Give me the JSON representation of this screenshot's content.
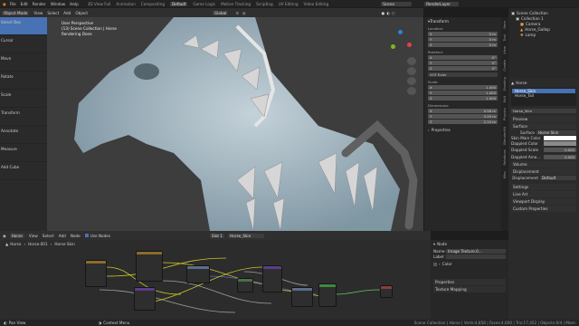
{
  "topbar": {
    "menus": [
      "File",
      "Edit",
      "Render",
      "Window",
      "Help"
    ],
    "tabs": [
      "3D View Full",
      "Animation",
      "Compositing",
      "Default",
      "Game Logic",
      "Motion Tracking",
      "Scripting",
      "UV Editing",
      "Video Editing"
    ],
    "active_tab": "Default",
    "scene": "Scene",
    "layer": "RenderLayer"
  },
  "viewport": {
    "mode": "Object Mode",
    "menus": [
      "View",
      "Select",
      "Add",
      "Object"
    ],
    "orientation": "Global",
    "overlay": [
      "User Perspective",
      "(13) Scene Collection | Horse",
      "Rendering Done"
    ]
  },
  "tools": [
    "Select Box",
    "Cursor",
    "Move",
    "Rotate",
    "Scale",
    "Transform",
    "Annotate",
    "Measure",
    "Add Cube"
  ],
  "transform": {
    "title": "Transform",
    "location": {
      "label": "Location:",
      "x": "0 m",
      "y": "0 m",
      "z": "0 m"
    },
    "rotation": {
      "label": "Rotation:",
      "x": "0°",
      "y": "0°",
      "z": "0°",
      "mode": "XYZ Euler"
    },
    "scale": {
      "label": "Scale:",
      "x": "1.000",
      "y": "1.000",
      "z": "1.000"
    },
    "dimensions": {
      "label": "Dimensions:",
      "x": "0.58 m",
      "y": "3.29 m",
      "z": "2.24 m"
    },
    "properties": "Properties"
  },
  "vtabs": [
    "Item",
    "Tool",
    "View",
    "Create",
    "Shading",
    "Edit",
    "Physics",
    "BlenderKit",
    "Relations",
    "Misc"
  ],
  "outliner": {
    "root": "Scene Collection",
    "items": [
      "Collection 1",
      "Camera",
      "Horse_Gallop",
      "Lamp"
    ]
  },
  "material": {
    "object": "Horse",
    "slots": [
      "Horse_Skin",
      "Horse_Tail"
    ],
    "name": "Horse_Skin",
    "preview": "Preview",
    "surface_section": "Surface",
    "surface_label": "Surface",
    "surface_value": "Horse Skin",
    "params": [
      {
        "label": "Skin Main Color",
        "value": ""
      },
      {
        "label": "Dappled Color",
        "value": ""
      },
      {
        "label": "Dappled Scale",
        "value": "0.000"
      },
      {
        "label": "Dappled Amo…",
        "value": "0.000"
      }
    ],
    "volume": "Volume",
    "displacement_section": "Displacement",
    "displacement_label": "Displacement",
    "displacement_value": "Default",
    "sections": [
      "Settings",
      "Line Art",
      "Viewport Display",
      "Custom Properties"
    ]
  },
  "node": {
    "menus": [
      "View",
      "Select",
      "Add",
      "Node"
    ],
    "use_nodes": "Use Nodes",
    "object": "Horse",
    "path": [
      "Horse.001",
      "Horse Skin"
    ],
    "slot": "Slot 1",
    "material": "Horse_Skin"
  },
  "nodeside": {
    "header": "Node",
    "name_label": "Name:",
    "name_value": "Image Texture.0…",
    "label_label": "Label:",
    "color": "Color",
    "properties": "Properties",
    "texture_mapping": "Texture Mapping"
  },
  "status": {
    "left": "Pan View",
    "mid": "Context Menu",
    "right": "Scene Collection | Horse | Verts:4,858 | Faces:4,600 | Tris:17,452 | Objects:0/4 | Mem:"
  },
  "colors": {
    "accent": "#4772b3",
    "skin_main": "#ffffff",
    "dappled": "#8a8a8a"
  }
}
